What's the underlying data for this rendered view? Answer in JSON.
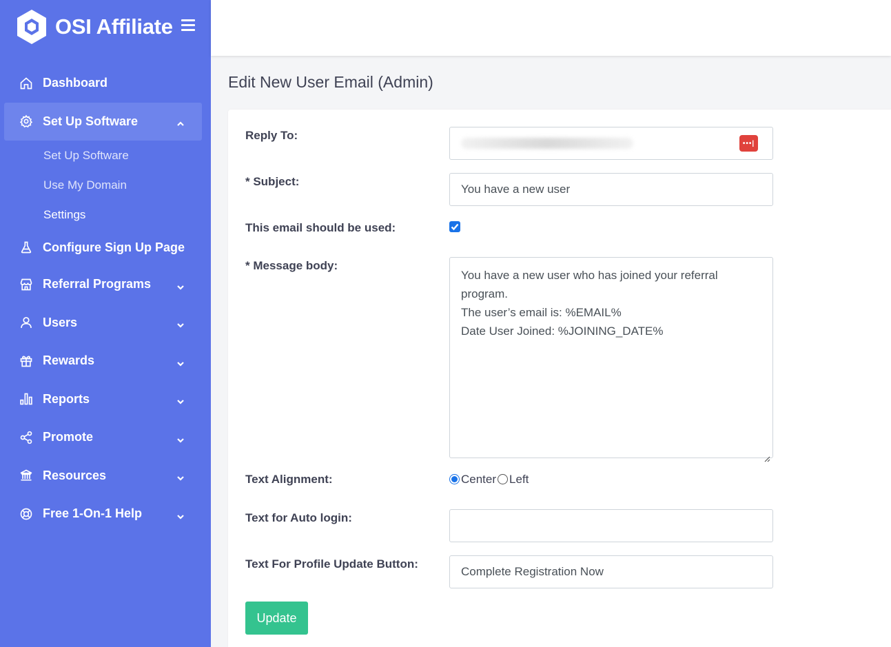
{
  "brand": {
    "name": "OSI Affiliate",
    "logo_icon": "hexagon-logo-icon",
    "menu_icon": "hamburger-icon"
  },
  "colors": {
    "sidebar_bg": "#5b73e8",
    "active_item_bg": "#6e84ec",
    "update_button": "#34c38f",
    "password_manager_icon": "#e0423c",
    "checkbox_accent": "#1a73e8"
  },
  "sidebar": {
    "items": [
      {
        "label": "Dashboard",
        "icon": "home-icon",
        "has_chevron": false
      },
      {
        "label": "Set Up Software",
        "icon": "gear-icon",
        "has_chevron": true,
        "expanded": true,
        "active": true,
        "children": [
          {
            "label": "Set Up Software"
          },
          {
            "label": "Use My Domain"
          },
          {
            "label": "Settings",
            "current": true
          }
        ]
      },
      {
        "label": "Configure Sign Up Page",
        "icon": "flask-icon",
        "has_chevron": false
      },
      {
        "label": "Referral Programs",
        "icon": "store-icon",
        "has_chevron": true
      },
      {
        "label": "Users",
        "icon": "user-icon",
        "has_chevron": true
      },
      {
        "label": "Rewards",
        "icon": "gift-icon",
        "has_chevron": true
      },
      {
        "label": "Reports",
        "icon": "bar-chart-icon",
        "has_chevron": true
      },
      {
        "label": "Promote",
        "icon": "share-icon",
        "has_chevron": true
      },
      {
        "label": "Resources",
        "icon": "bank-icon",
        "has_chevron": true
      },
      {
        "label": "Free 1-On-1 Help",
        "icon": "lifebuoy-icon",
        "has_chevron": true
      }
    ]
  },
  "page": {
    "title": "Edit New User Email (Admin)"
  },
  "form": {
    "reply_to": {
      "label": "Reply To:",
      "value": "",
      "password_manager_icon": "password-manager-icon"
    },
    "subject": {
      "label": "* Subject:",
      "value": "You have a new user"
    },
    "use_email": {
      "label": "This email should be used:",
      "checked": true
    },
    "message_body": {
      "label": "* Message body:",
      "lines": [
        "You have a new user who has joined your referral",
        "program.",
        "The user’s email is: %EMAIL%",
        "Date User Joined: %JOINING_DATE%"
      ]
    },
    "text_alignment": {
      "label": "Text Alignment:",
      "options": [
        "Center",
        "Left"
      ],
      "selected": "Center"
    },
    "auto_login": {
      "label": "Text for Auto login:",
      "value": ""
    },
    "profile_update": {
      "label": "Text For Profile Update Button:",
      "value": "Complete Registration Now"
    },
    "update_button": "Update"
  }
}
